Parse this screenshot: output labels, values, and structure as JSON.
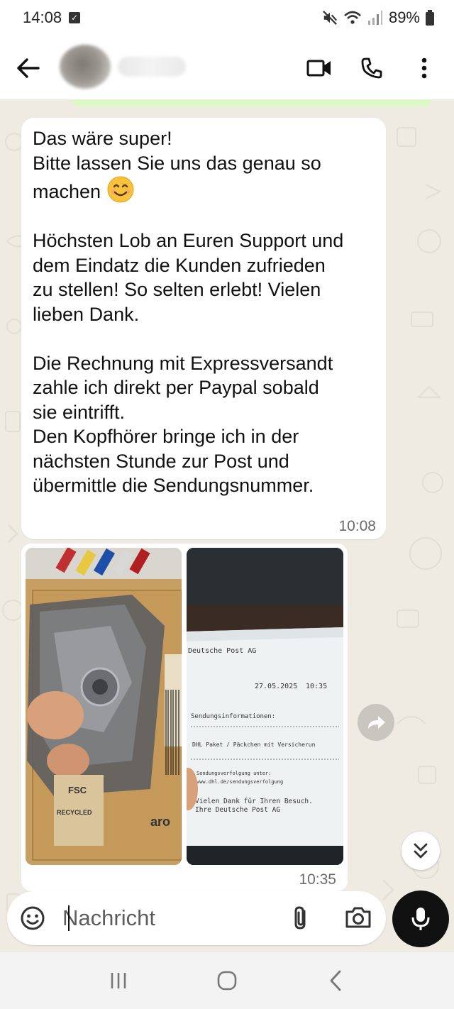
{
  "status_bar": {
    "time": "14:08",
    "battery": "89%"
  },
  "conversation": {
    "contact_name": "",
    "message": {
      "text_lines_1": "Das wäre super!\nBitte lassen Sie uns das genau so\nmachen ",
      "text_lines_2": "\n\nHöchsten Lob an Euren Support und\ndem Eindatz die Kunden zufrieden\nzu stellen! So selten erlebt! Vielen\nlieben Dank.\n\nDie Rechnung mit Expressversandt\nzahle ich direkt per Paypal sobald\nsie eintrifft.\nDen Kopfhörer bringe ich in der\nnächsten Stunde zur Post und\nübermittle die Sendungsnummer.",
      "time": "10:08"
    },
    "media_message": {
      "time": "10:35",
      "left_photo": {
        "fsc_label": "FSC",
        "recycled_label": "RECYCLED",
        "package_brand": "aro"
      },
      "right_photo": {
        "receipt_company": "Deutsche Post AG",
        "receipt_date": "27.05.2025",
        "receipt_time": "10:35",
        "receipt_section": "Sendungsinformationen:",
        "receipt_product": "DHL Paket / Päckchen mit Versicherun",
        "receipt_tracking_line1": "Sendungsverfolgung unter:",
        "receipt_tracking_line2": "www.dhl.de/sendungsverfolgung",
        "receipt_thanks": "Vielen Dank für Ihren Besuch.",
        "receipt_sign": "Ihre Deutsche Post AG"
      }
    }
  },
  "composer": {
    "placeholder": "Nachricht"
  },
  "icons": {
    "status_checkbox": "checkbox-icon",
    "mute": "mute-icon",
    "wifi": "wifi-icon",
    "signal": "signal-icon",
    "battery": "battery-icon",
    "back": "arrow-left-icon",
    "video": "video-camera-icon",
    "call": "phone-icon",
    "more": "more-vert-icon",
    "forward": "forward-icon",
    "scroll": "chevrons-down-icon",
    "emoji": "emoji-icon",
    "attach": "paperclip-icon",
    "camera": "camera-icon",
    "mic": "microphone-icon",
    "recents": "recents-icon",
    "home": "home-icon",
    "nav_back": "chevron-left-icon"
  },
  "colors": {
    "chat_background": "#efeae2",
    "bubble": "#ffffff",
    "mic_button": "#111111",
    "sent_strip": "#dcf8c6"
  }
}
